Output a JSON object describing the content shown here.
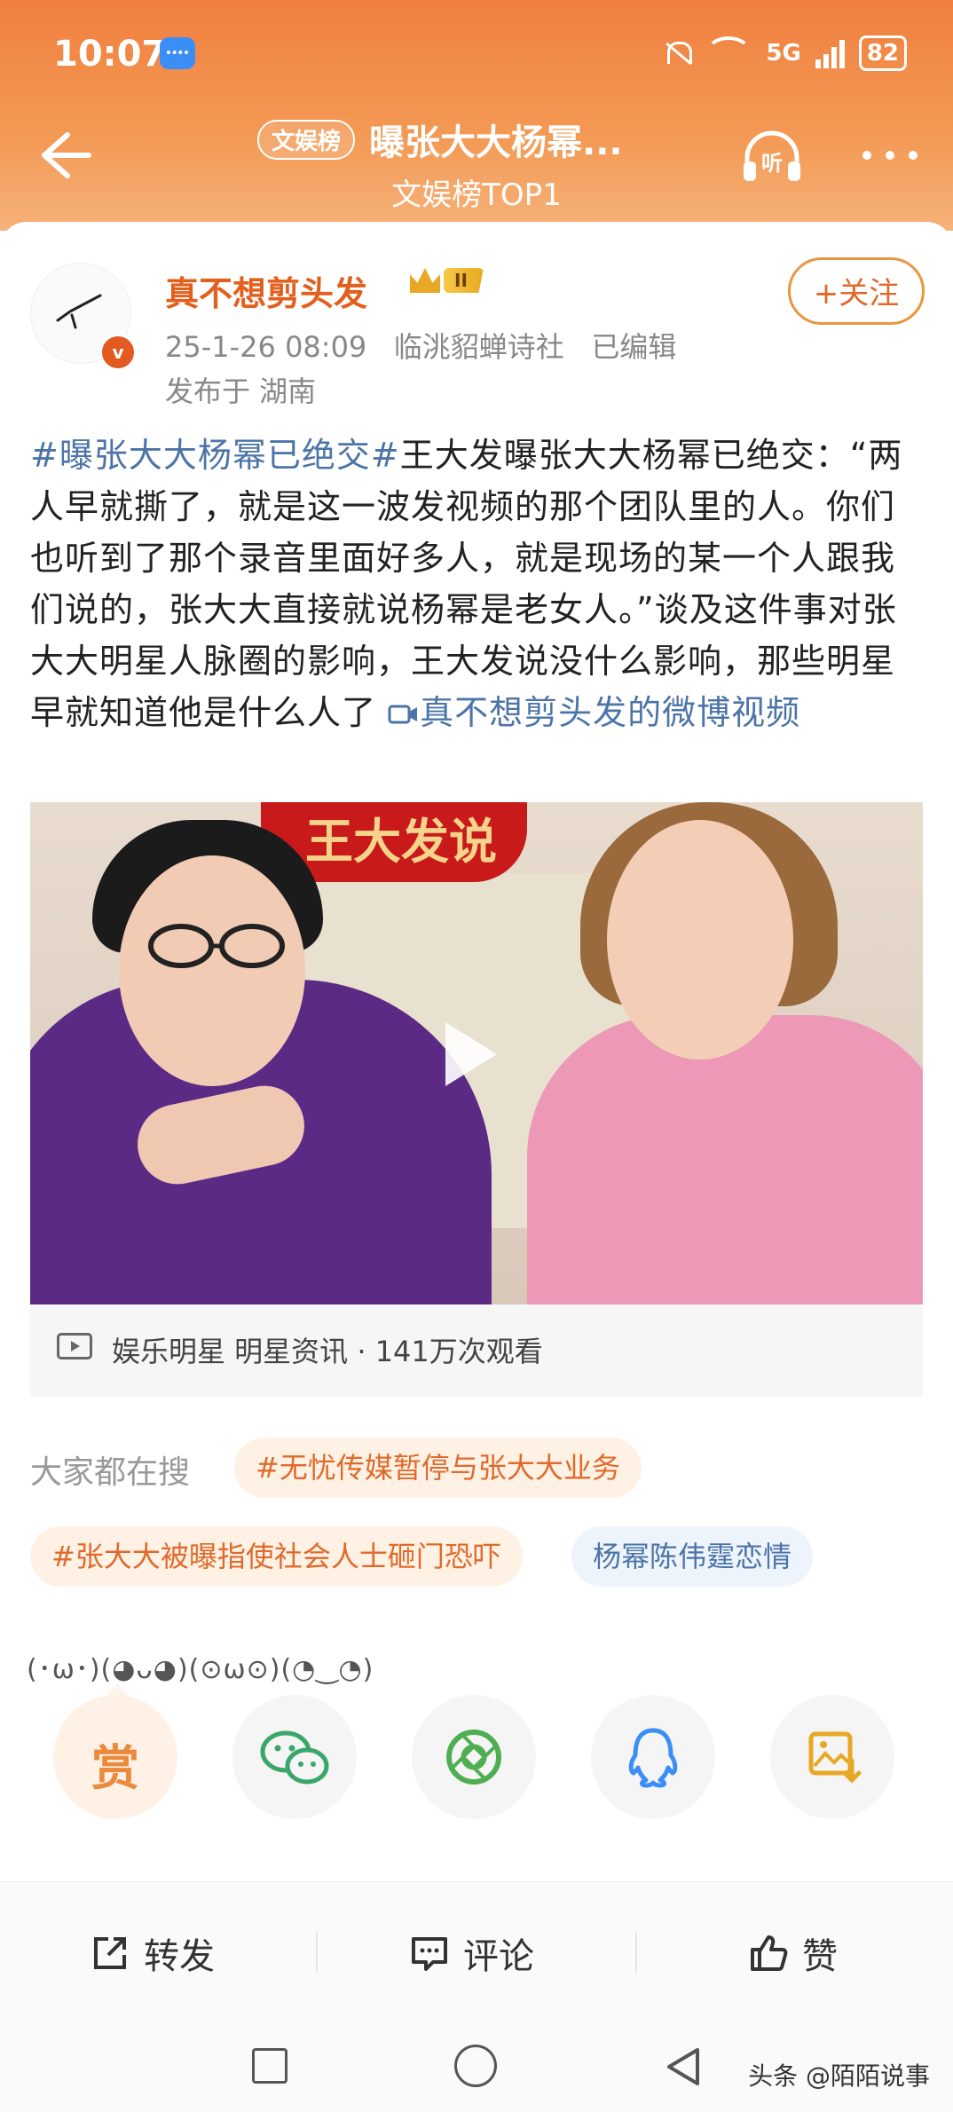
{
  "status_bar": {
    "time": "10:07",
    "network": "5G",
    "battery": "82"
  },
  "header": {
    "tag": "文娱榜",
    "title": "曝张大大杨幂...",
    "subtitle": "文娱榜TOP1",
    "listen_label": "听"
  },
  "author": {
    "name": "真不想剪头发",
    "level": "II",
    "verified_label": "v",
    "timestamp": "25-1-26 08:09",
    "source": "临洮貂蝉诗社",
    "edited": "已编辑",
    "location": "发布于 湖南",
    "follow_label": "+关注"
  },
  "post": {
    "hashtag": "#曝张大大杨幂已绝交#",
    "body": "王大发曝张大大杨幂已绝交：“两人早就撕了，就是这一波发视频的那个团队里的人。你们也听到了那个录音里面好多人，就是现场的某一个人跟我们说的，张大大直接就说杨幂是老女人。”谈及这件事对张大大明星人脉圈的影响，王大发说没什么影响，那些明星早就知道他是什么人了",
    "video_link": "真不想剪头发的微博视频"
  },
  "video": {
    "banner_text": "王大发说",
    "info": "娱乐明星 明星资讯 · 141万次观看"
  },
  "search": {
    "label": "大家都在搜",
    "chips": [
      {
        "text": "#无忧传媒暂停与张大大业务"
      },
      {
        "text": "#张大大被曝指使社会人士砸门恐吓"
      },
      {
        "text": "杨幂陈伟霆恋情"
      }
    ]
  },
  "emoticons": "(･ω･)(◕ᴗ◕)(⊙ω⊙)(◔‿◔)",
  "share": {
    "reward_label": "赏",
    "icons": [
      "reward-icon",
      "wechat-icon",
      "moments-icon",
      "qq-icon",
      "save-image-icon"
    ]
  },
  "actions": {
    "repost": "转发",
    "comment": "评论",
    "like": "赞"
  },
  "watermark": "头条 @陌陌说事",
  "colors": {
    "accent": "#e35f1d",
    "link": "#4c74a8",
    "header": "#f07f3f"
  }
}
